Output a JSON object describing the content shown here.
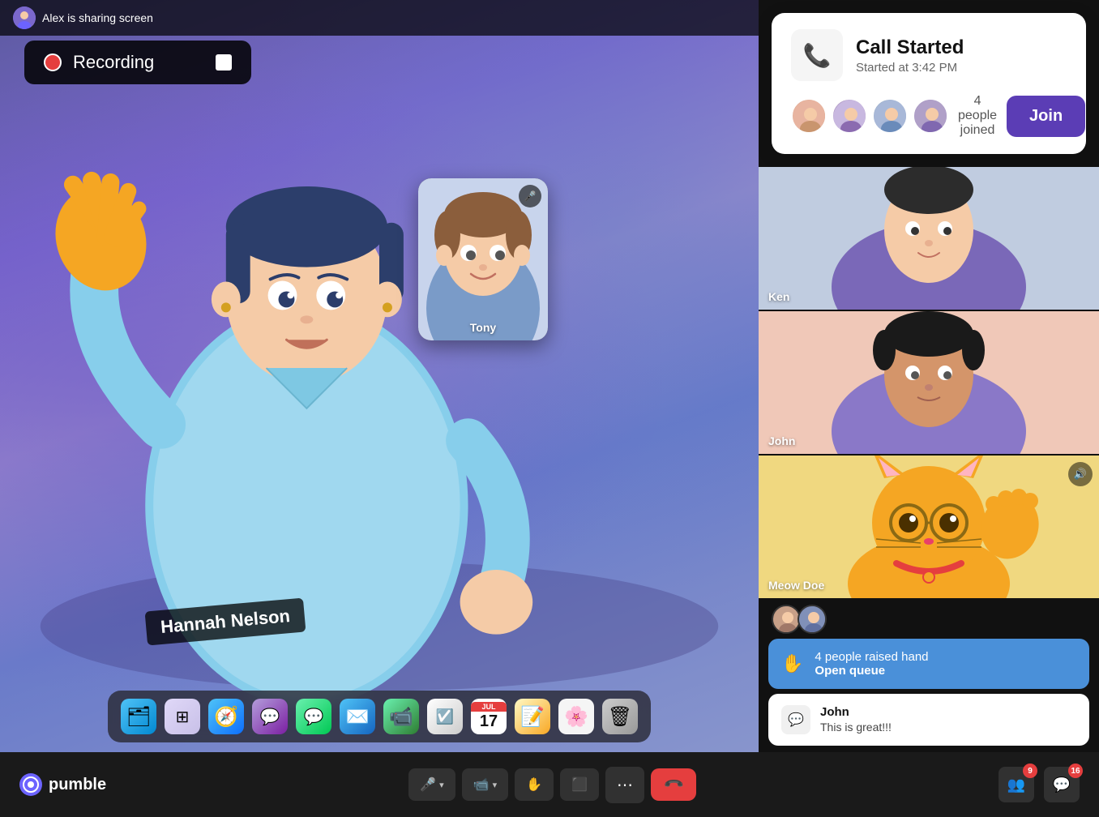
{
  "app": {
    "brand": "pumble",
    "brand_icon": "○"
  },
  "screen_share": {
    "user": "Alex",
    "label": "Alex is sharing screen"
  },
  "recording": {
    "label": "Recording"
  },
  "video_main": {
    "presenter_name": "Hannah Nelson",
    "mini_card_name": "Tony"
  },
  "call_popup": {
    "title": "Call Started",
    "subtitle": "Started at 3:42 PM",
    "participant_count_label": "4 people joined",
    "join_button": "Join"
  },
  "participants": [
    {
      "name": "Ken",
      "tile_class": "tile-ken"
    },
    {
      "name": "John",
      "tile_class": "tile-john"
    },
    {
      "name": "Meow Doe",
      "tile_class": "tile-meow",
      "has_speaker": true
    }
  ],
  "raised_hand": {
    "count_label": "4 people raised hand",
    "action_label": "Open queue"
  },
  "chat_message": {
    "sender": "John",
    "text": "This is great!!!"
  },
  "toolbar": {
    "mic_label": "🎤",
    "camera_label": "📹",
    "hand_label": "✋",
    "screen_label": "⬛",
    "more_label": "⋯",
    "end_call_label": "📞",
    "participants_badge": "9",
    "chat_badge": "16"
  },
  "dock": [
    {
      "icon": "🗂",
      "label": "Finder",
      "color": "di-finder"
    },
    {
      "icon": "⊞",
      "label": "Launchpad",
      "color": "di-launchpad"
    },
    {
      "icon": "🧭",
      "label": "Safari",
      "color": "di-safari"
    },
    {
      "icon": "💬",
      "label": "Messages Alt",
      "color": "di-notes2"
    },
    {
      "icon": "💬",
      "label": "Messages",
      "color": "di-messages"
    },
    {
      "icon": "✉",
      "label": "Mail",
      "color": "di-mail"
    },
    {
      "icon": "📹",
      "label": "FaceTime",
      "color": "di-facetime"
    },
    {
      "icon": "☑",
      "label": "Reminders",
      "color": "di-reminders"
    },
    {
      "icon": "17",
      "label": "Calendar",
      "color": "di-calendar"
    },
    {
      "icon": "📝",
      "label": "Notes",
      "color": "di-notes"
    },
    {
      "icon": "🌸",
      "label": "Photos",
      "color": "di-photos"
    },
    {
      "icon": "🗑",
      "label": "Trash",
      "color": "di-trash"
    }
  ]
}
